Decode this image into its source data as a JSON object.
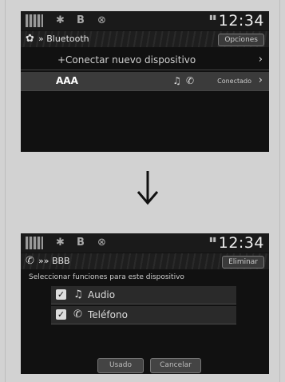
{
  "status": {
    "time": "12:34"
  },
  "screen1": {
    "title": "Bluetooth",
    "options_button": "Opciones",
    "rows": [
      {
        "label": "+Conectar nuevo dispositivo"
      },
      {
        "label": "AAA",
        "status": "Conectado"
      }
    ]
  },
  "screen2": {
    "title": "BBB",
    "delete_button": "Eliminar",
    "hint": "Seleccionar funciones para este dispositivo",
    "options": [
      {
        "label": "Audio",
        "checked": true,
        "icon": "music-note-icon"
      },
      {
        "label": "Teléfono",
        "checked": true,
        "icon": "phone-icon"
      }
    ],
    "buttons": {
      "ok": "Usado",
      "cancel": "Cancelar"
    }
  }
}
